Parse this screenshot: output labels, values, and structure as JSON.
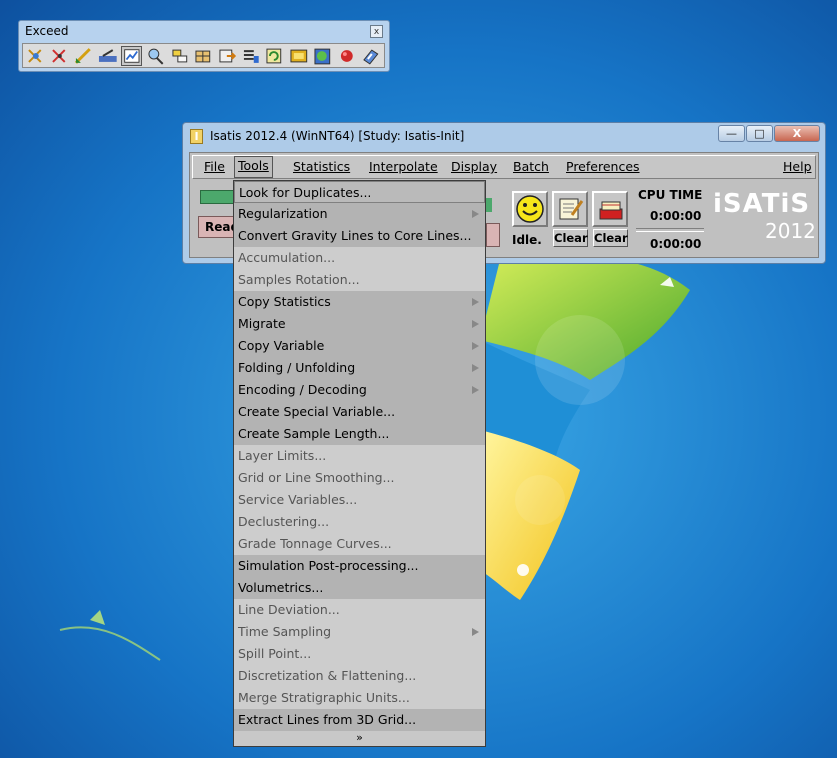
{
  "exceed": {
    "title": "Exceed",
    "close_label": "x",
    "tools": [
      "select-icon",
      "cut-icon",
      "draw-icon",
      "measure-icon",
      "chart-icon",
      "zoom-icon",
      "layer-icon",
      "grid-icon",
      "export-icon",
      "list-icon",
      "refresh-icon",
      "palette-icon",
      "globe-icon",
      "record-icon",
      "help-icon"
    ]
  },
  "window": {
    "title": "Isatis 2012.4 (WinNT64) [Study: Isatis-Init]",
    "icon_letter": "I",
    "minimize": "—",
    "maximize": "□",
    "close": "X"
  },
  "menubar": {
    "file": "File",
    "tools": "Tools",
    "statistics": "Statistics",
    "interpolate": "Interpolate",
    "display": "Display",
    "batch": "Batch",
    "preferences": "Preferences",
    "help": "Help"
  },
  "status": {
    "text": "Read",
    "idle": "Idle.",
    "clear1": "Clear",
    "clear2": "Clear",
    "cpu_label": "CPU TIME",
    "time1": "0:00:00",
    "time2": "0:00:00"
  },
  "logo": {
    "text": "iSATiS",
    "year": "2012"
  },
  "tools_menu": {
    "items": [
      {
        "label": "Look for Duplicates...",
        "enabled": true,
        "submenu": false
      },
      {
        "label": "Regularization",
        "enabled": true,
        "submenu": true
      },
      {
        "label": "Convert Gravity Lines to Core Lines...",
        "enabled": true,
        "submenu": false
      },
      {
        "label": "Accumulation...",
        "enabled": false,
        "submenu": false
      },
      {
        "label": "Samples Rotation...",
        "enabled": false,
        "submenu": false
      },
      {
        "label": "Copy Statistics",
        "enabled": true,
        "submenu": true
      },
      {
        "label": "Migrate",
        "enabled": true,
        "submenu": true
      },
      {
        "label": "Copy Variable",
        "enabled": true,
        "submenu": true
      },
      {
        "label": "Folding / Unfolding",
        "enabled": true,
        "submenu": true
      },
      {
        "label": "Encoding / Decoding",
        "enabled": true,
        "submenu": true
      },
      {
        "label": "Create Special Variable...",
        "enabled": true,
        "submenu": false
      },
      {
        "label": "Create Sample Length...",
        "enabled": true,
        "submenu": false
      },
      {
        "label": "Layer Limits...",
        "enabled": false,
        "submenu": false
      },
      {
        "label": "Grid or Line Smoothing...",
        "enabled": false,
        "submenu": false
      },
      {
        "label": "Service Variables...",
        "enabled": false,
        "submenu": false
      },
      {
        "label": "Declustering...",
        "enabled": false,
        "submenu": false
      },
      {
        "label": "Grade Tonnage Curves...",
        "enabled": false,
        "submenu": false
      },
      {
        "label": "Simulation Post-processing...",
        "enabled": true,
        "submenu": false
      },
      {
        "label": "Volumetrics...",
        "enabled": true,
        "submenu": false
      },
      {
        "label": "Line Deviation...",
        "enabled": false,
        "submenu": false
      },
      {
        "label": "Time Sampling",
        "enabled": false,
        "submenu": true
      },
      {
        "label": "Spill Point...",
        "enabled": false,
        "submenu": false
      },
      {
        "label": "Discretization & Flattening...",
        "enabled": false,
        "submenu": false
      },
      {
        "label": "Merge Stratigraphic Units...",
        "enabled": false,
        "submenu": false
      },
      {
        "label": "Extract Lines from 3D Grid...",
        "enabled": true,
        "submenu": false
      }
    ],
    "more": "»"
  }
}
